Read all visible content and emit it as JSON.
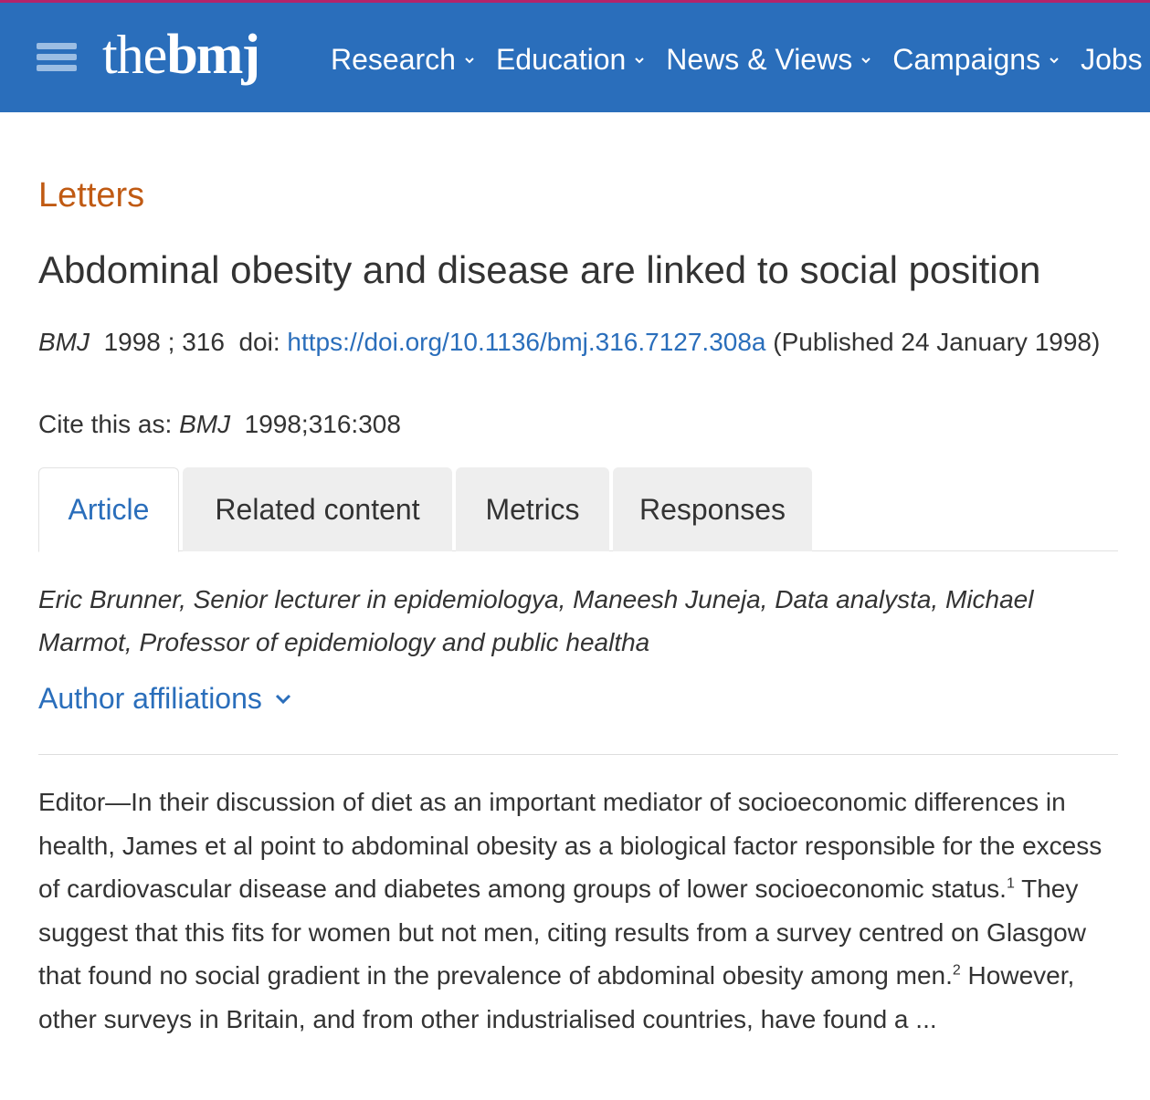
{
  "header": {
    "logo_the": "the",
    "logo_bmj": "bmj",
    "nav": [
      {
        "label": "Research"
      },
      {
        "label": "Education"
      },
      {
        "label": "News & Views"
      },
      {
        "label": "Campaigns"
      },
      {
        "label": "Jobs"
      }
    ]
  },
  "article": {
    "section": "Letters",
    "title": "Abdominal obesity and disease are linked to social position",
    "journal": "BMJ",
    "year_vol": "1998 ; 316",
    "doi_label": "doi:",
    "doi_url": "https://doi.org/10.1136/bmj.316.7127.308a",
    "published": "(Published 24 January 1998)",
    "cite_label": "Cite this as:",
    "cite_journal": "BMJ",
    "cite_ref": "1998;316:308"
  },
  "tabs": [
    {
      "label": "Article"
    },
    {
      "label": "Related content"
    },
    {
      "label": "Metrics"
    },
    {
      "label": "Responses"
    }
  ],
  "authors": "Eric Brunner, Senior lecturer in epidemiologya, Maneesh Juneja, Data analysta, Michael Marmot, Professor of epidemiology and public healtha",
  "affiliations_label": "Author affiliations",
  "body": {
    "part1": "Editor—In their discussion of diet as an important mediator of socioeconomic differences in health, James et al point to abdominal obesity as a biological factor responsible for the excess of cardiovascular disease and diabetes among groups of lower socioeconomic status.",
    "ref1": "1",
    "part2": " They suggest that this fits for women but not men, citing results from a survey centred on Glasgow that found no social gradient in the prevalence of abdominal obesity among men.",
    "ref2": "2",
    "part3": " However, other surveys in Britain, and from other industrialised countries, have found a ..."
  },
  "colors": {
    "header_bg": "#2a6ebb",
    "header_top_border": "#b3246b",
    "section_label": "#c05a13",
    "link": "#2a6ebb"
  },
  "icons": {
    "menu": "hamburger-icon",
    "nav_dropdown": "chevron-down-icon",
    "affiliations": "chevron-down-icon"
  }
}
